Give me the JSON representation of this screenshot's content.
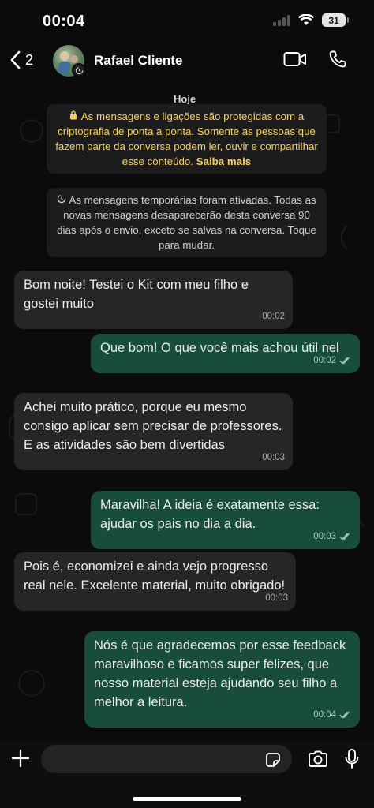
{
  "status_bar": {
    "time": "00:04",
    "battery": "31"
  },
  "header": {
    "back_count": "2",
    "contact_name": "Rafael Cliente"
  },
  "chat": {
    "date_label": "Hoje",
    "encryption_notice": "As mensagens e ligações são protegidas com a criptografia de ponta a ponta. Somente as pessoas que fazem parte da conversa podem ler, ouvir e compartilhar esse conteúdo.",
    "encryption_link": "Saiba mais",
    "temp_notice": "As mensagens temporárias foram ativadas. Todas as novas mensagens desaparecerão desta conversa 90 dias após o envio, exceto se salvas na conversa. Toque para mudar.",
    "messages": [
      {
        "direction": "in",
        "text": "Bom noite! Testei o Kit com meu filho e gostei muito",
        "time": "00:02"
      },
      {
        "direction": "out",
        "text": "Que bom! O que você mais achou útil nel",
        "time": "00:02"
      },
      {
        "direction": "in",
        "text": "Achei muito prático, porque eu mesmo consigo aplicar sem precisar de professores. E as atividades são bem divertidas",
        "time": "00:03"
      },
      {
        "direction": "out",
        "text": "Maravilha! A ideia é exatamente essa: ajudar os pais no dia a dia.",
        "time": "00:03"
      },
      {
        "direction": "in",
        "text": "Pois é, economizei e ainda vejo progresso real nele. Excelente material, muito obrigado!",
        "time": "00:03"
      },
      {
        "direction": "out",
        "text": "Nós é que agradecemos por esse feedback maravilhoso e ficamos super felizes, que nosso material esteja ajudando seu filho a melhor a leitura.",
        "time": "00:04"
      }
    ]
  },
  "input": {
    "placeholder": ""
  },
  "colors": {
    "incoming_bubble": "#262626",
    "outgoing_bubble": "#174d39",
    "notice_text": "#f6cf62"
  }
}
